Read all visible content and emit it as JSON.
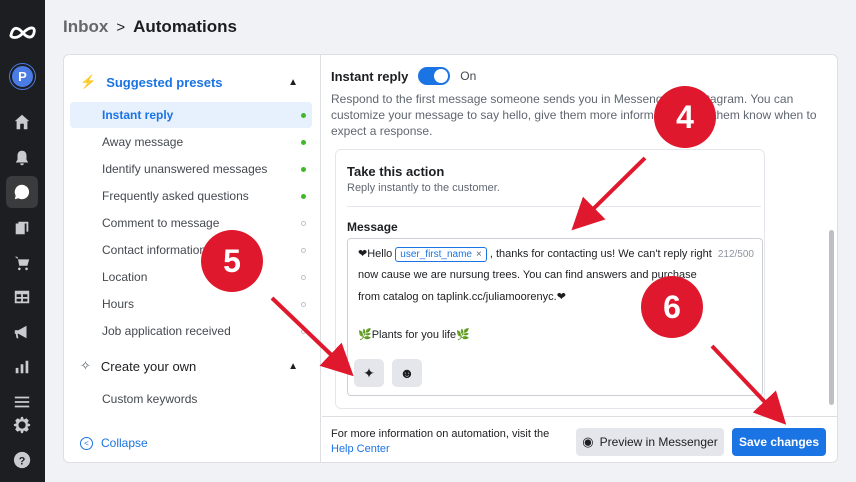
{
  "header": {
    "inbox": "Inbox",
    "separator": ">",
    "current": "Automations"
  },
  "rail": {
    "avatar_letter": "P",
    "icons": [
      "meta-logo",
      "home-icon",
      "bell-icon",
      "chat-icon",
      "pages-icon",
      "cart-icon",
      "table-icon",
      "megaphone-icon",
      "chart-icon",
      "menu-icon",
      "settings-icon",
      "help-icon"
    ]
  },
  "sidebar": {
    "suggested_title": "Suggested presets",
    "items": [
      {
        "label": "Instant reply",
        "on": true
      },
      {
        "label": "Away message",
        "on": true
      },
      {
        "label": "Identify unanswered messages",
        "on": true
      },
      {
        "label": "Frequently asked questions",
        "on": true
      },
      {
        "label": "Comment to message",
        "on": false
      },
      {
        "label": "Contact information",
        "on": false
      },
      {
        "label": "Location",
        "on": false
      },
      {
        "label": "Hours",
        "on": false
      },
      {
        "label": "Job application received",
        "on": false
      }
    ],
    "create_title": "Create your own",
    "custom_item": "Custom keywords",
    "collapse": "Collapse"
  },
  "main": {
    "instant_reply_label": "Instant reply",
    "toggle_state": "On",
    "description": "Respond to the first message someone sends you in Messenger or Instagram. You can customize your message to say hello, give them more information or let them know when to expect a response.",
    "action_title": "Take this action",
    "action_subtitle": "Reply instantly to the customer.",
    "message_label": "Message",
    "message": {
      "prefix": "❤Hello",
      "chip": "user_first_name",
      "chip_close": "×",
      "rest1": ", thanks for contacting us! We can't reply right",
      "line2": "now cause we are nursung trees. You can find answers and purchase",
      "line3": "from catalog on taplink.cc/juliamoorenyc.❤",
      "line4": "🌿Plants for you life🌿",
      "counter": "212/500"
    },
    "footer_note": "For more information on automation, visit the",
    "help_link": "Help Center",
    "preview_button": "Preview in Messenger",
    "save_button": "Save changes"
  },
  "annotations": {
    "c4": "4",
    "c5": "5",
    "c6": "6"
  },
  "colors": {
    "accent": "#1b74e4",
    "callout": "#e0182d",
    "rail": "#1c1e21"
  }
}
